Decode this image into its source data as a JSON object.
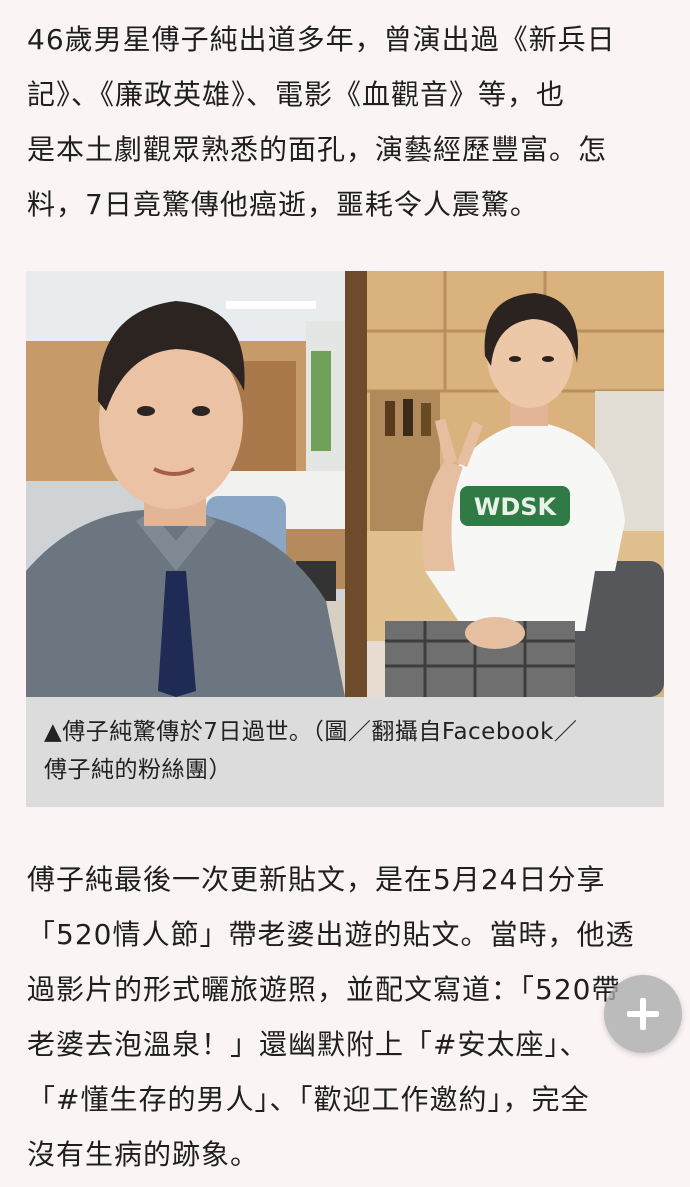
{
  "article": {
    "paragraph_1": [
      "46歲男星傅子純出道多年，曾演出過《新兵日",
      "記》、《廉政英雄》、電影《血觀音》等，也",
      "是本土劇觀眾熟悉的面孔，演藝經歷豐富。怎",
      "料，7日竟驚傳他癌逝，噩耗令人震驚。"
    ],
    "figure": {
      "caption": [
        "▲傅子純驚傳於7日過世。（圖／翻攝自Facebook／",
        "傅子純的粉絲團）"
      ],
      "left_photo": "selfie-office-icon",
      "right_photo": "peace-sign-portrait-icon",
      "shirt_print": "WDSK"
    },
    "paragraph_2": [
      "傅子純最後一次更新貼文，是在5月24日分享",
      "「520情人節」帶老婆出遊的貼文。當時，他透",
      "過影片的形式曬旅遊照，並配文寫道：「520帶",
      "老婆去泡溫泉！」還幽默附上「#安太座」、",
      "「#懂生存的男人」、「歡迎工作邀約」，完全",
      "沒有生病的跡象。"
    ]
  },
  "floating_button": {
    "icon": "plus-icon"
  },
  "colors": {
    "page_background": "#fbf4f4",
    "text": "#1f1f1f",
    "caption_background": "#dcdcdc",
    "fab": "#aaaaaa"
  }
}
